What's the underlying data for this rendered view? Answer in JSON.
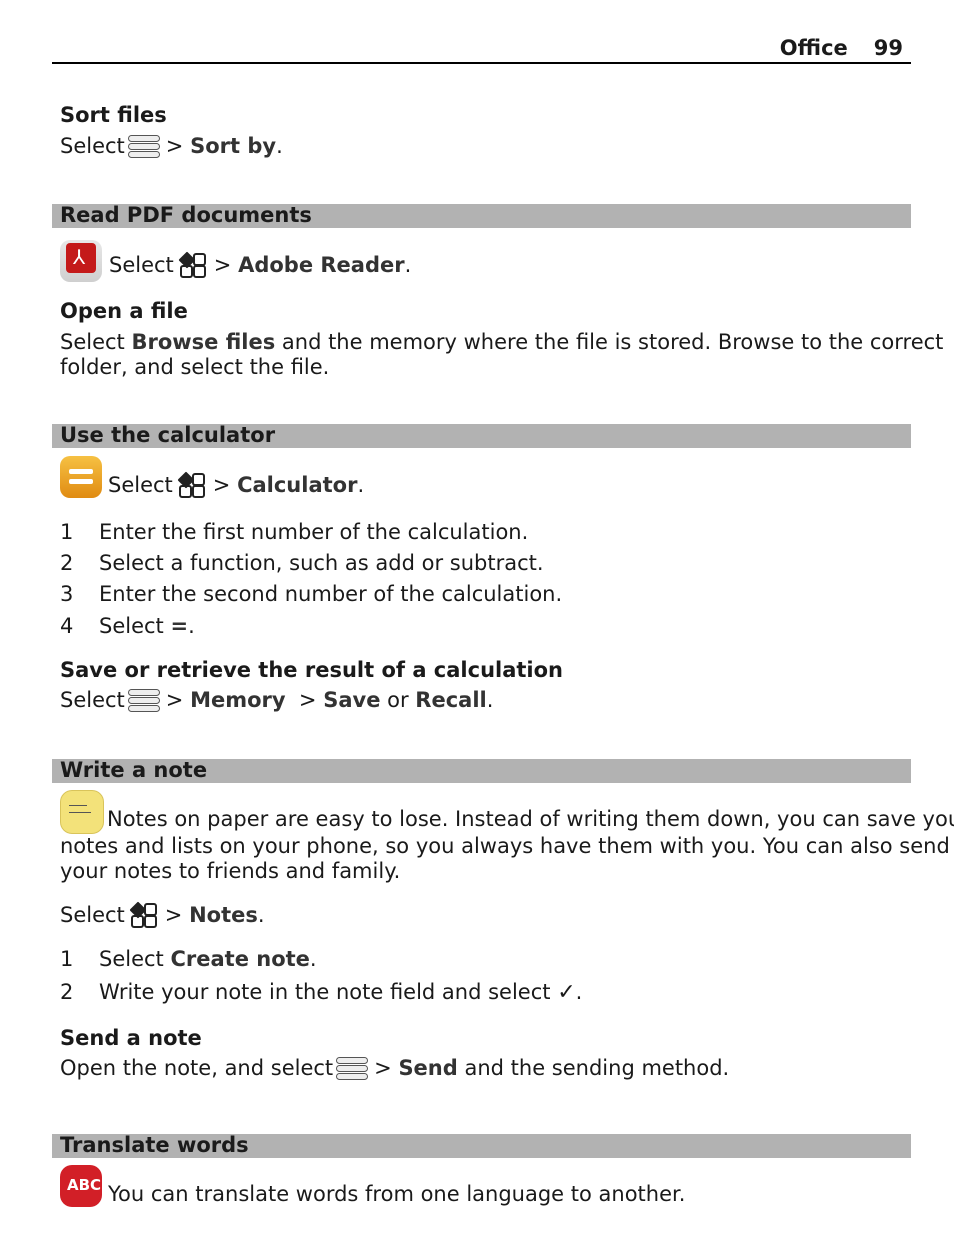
{
  "header": {
    "chapter": "Office",
    "page": "99"
  },
  "sort_files": {
    "title": "Sort files",
    "select": "Select",
    "path": "> ",
    "target": "Sort by",
    "end": "."
  },
  "read_pdf": {
    "bar": "Read PDF documents",
    "select": "Select",
    "path": "> ",
    "target": "Adobe Reader",
    "end": ".",
    "open_title": "Open a file",
    "open_line1_pre": "Select ",
    "open_line1_bold": "Browse files",
    "open_line1_post": " and the memory where the file is stored. Browse to the correct",
    "open_line2": "folder, and select the file."
  },
  "calculator": {
    "bar": "Use the calculator",
    "select": "Select",
    "path": "> ",
    "target": "Calculator",
    "end": ".",
    "steps": [
      {
        "n": "1",
        "text": "Enter the first number of the calculation."
      },
      {
        "n": "2",
        "text": "Select a function, such as add or subtract."
      },
      {
        "n": "3",
        "text": "Enter the second number of the calculation."
      },
      {
        "n": "4",
        "pre": "Select ",
        "bold": "=",
        "post": "."
      }
    ],
    "save_title": "Save or retrieve the result of a calculation",
    "save_select": "Select",
    "save_p1": "> ",
    "save_b1": "Memory",
    "save_p2": "  > ",
    "save_b2": "Save",
    "save_or": " or ",
    "save_b3": "Recall",
    "save_end": "."
  },
  "notes": {
    "bar": "Write a note",
    "intro1": "Notes on paper are easy to lose. Instead of writing them down, you can save your",
    "intro2": "notes and lists on your phone, so you always have them with you. You can also send",
    "intro3": "your notes to friends and family.",
    "select": "Select",
    "path": "> ",
    "target": "Notes",
    "end": ".",
    "steps": [
      {
        "n": "1",
        "pre": "Select ",
        "bold": "Create note",
        "post": "."
      },
      {
        "n": "2",
        "pre": "Write your note in the note field and select ",
        "post": "."
      }
    ],
    "send_title": "Send a note",
    "send_pre": "Open the note, and select",
    "send_path": "> ",
    "send_bold": "Send",
    "send_post": " and the sending method."
  },
  "translate": {
    "bar": "Translate words",
    "icon_label": "ABC",
    "text": "You can translate words from one language to another."
  }
}
